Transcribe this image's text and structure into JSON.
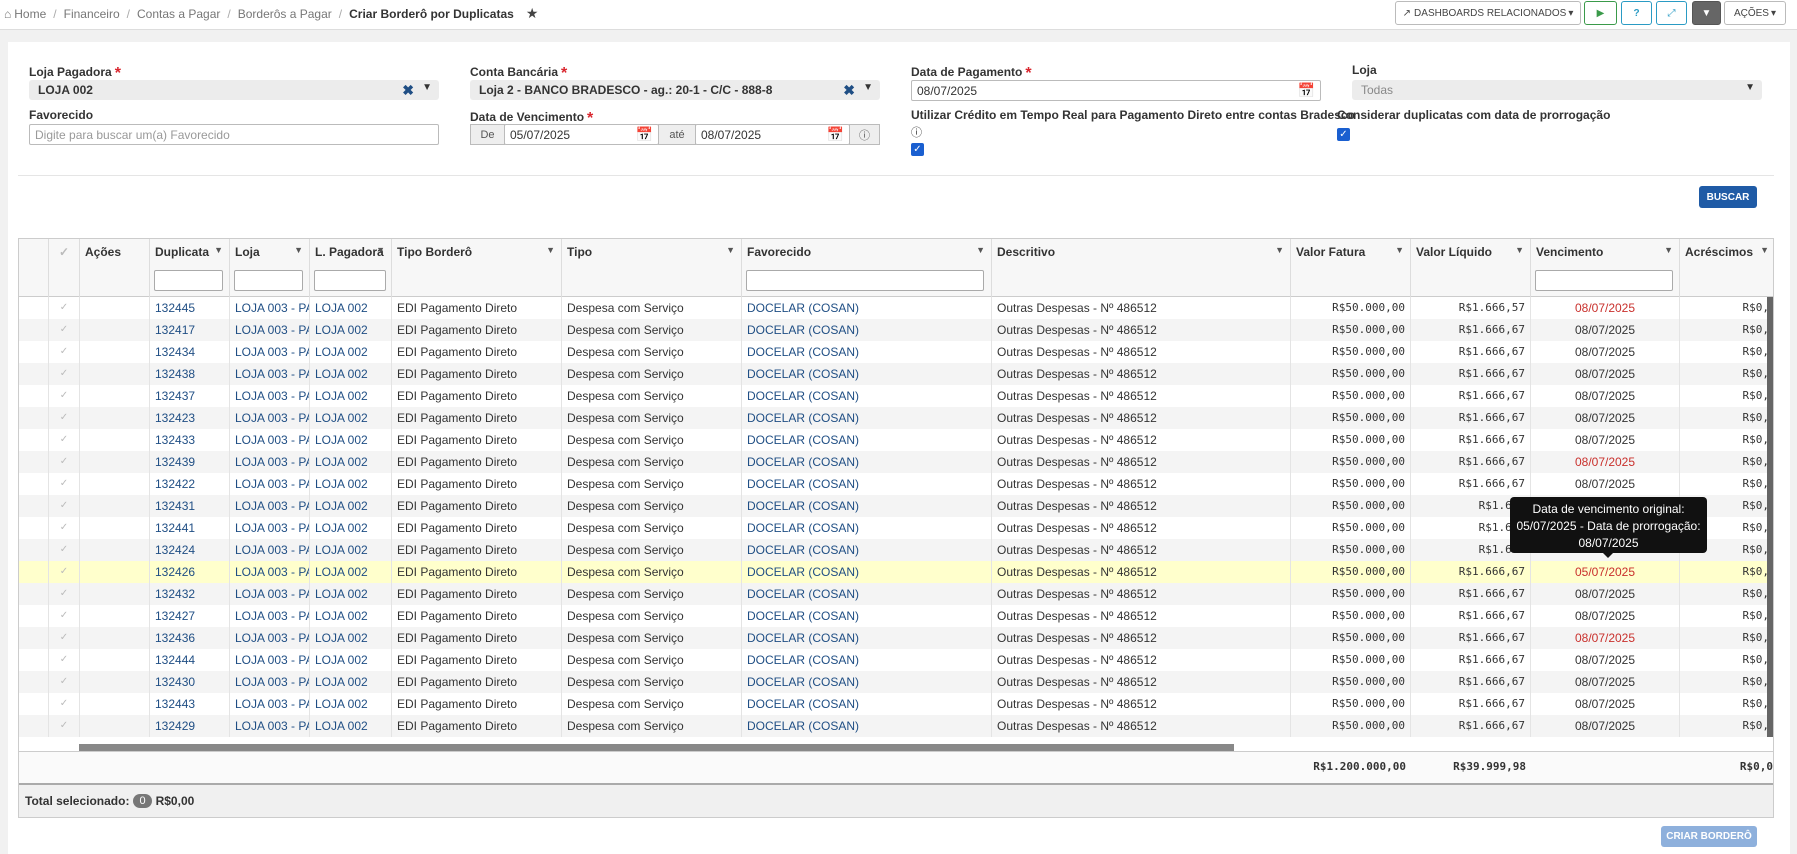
{
  "breadcrumb": {
    "home": "Home",
    "items": [
      "Financeiro",
      "Contas a Pagar",
      "Borderôs a Pagar"
    ],
    "current": "Criar Borderô por Duplicatas"
  },
  "toolbar": {
    "dashboards": "DASHBOARDS RELACIONADOS",
    "acoes": "AÇÕES"
  },
  "form": {
    "loja_pagadora": {
      "label": "Loja Pagadora",
      "value": "LOJA 002"
    },
    "conta_bancaria": {
      "label": "Conta Bancária",
      "value": "Loja 2 - BANCO BRADESCO - ag.: 20-1 - C/C - 888-8"
    },
    "data_pagamento": {
      "label": "Data de Pagamento",
      "value": "08/07/2025"
    },
    "loja": {
      "label": "Loja",
      "value": "Todas"
    },
    "favorecido": {
      "label": "Favorecido",
      "placeholder": "Digite para buscar um(a) Favorecido"
    },
    "data_vencimento": {
      "label": "Data de Vencimento",
      "de_label": "De",
      "de": "05/07/2025",
      "ate_label": "até",
      "ate": "08/07/2025"
    },
    "credito": {
      "label": "Utilizar Crédito em Tempo Real para Pagamento Direto entre contas Bradesco",
      "checked": true
    },
    "prorrogacao": {
      "label": "Considerar duplicatas com data de prorrogação",
      "checked": true
    },
    "buscar": "BUSCAR"
  },
  "grid": {
    "columns": [
      "Ações",
      "Duplicata",
      "Loja",
      "L. Pagadora",
      "Tipo Borderô",
      "Tipo",
      "Favorecido",
      "Descritivo",
      "Valor Fatura",
      "Valor Líquido",
      "Vencimento",
      "Acréscimos"
    ],
    "rows": [
      {
        "dup": "132445",
        "loja": "LOJA 003 - PAR",
        "lpag": "LOJA 002",
        "tipob": "EDI Pagamento Direto",
        "tipo": "Despesa com Serviço",
        "fav": "DOCELAR (COSAN)",
        "desc": "Outras Despesas - Nº 486512",
        "vf": "R$50.000,00",
        "vl": "R$1.666,57",
        "venc": "08/07/2025",
        "red": true,
        "acr": "R$0,"
      },
      {
        "dup": "132417",
        "loja": "LOJA 003 - PAR",
        "lpag": "LOJA 002",
        "tipob": "EDI Pagamento Direto",
        "tipo": "Despesa com Serviço",
        "fav": "DOCELAR (COSAN)",
        "desc": "Outras Despesas - Nº 486512",
        "vf": "R$50.000,00",
        "vl": "R$1.666,67",
        "venc": "08/07/2025",
        "red": false,
        "acr": "R$0,"
      },
      {
        "dup": "132434",
        "loja": "LOJA 003 - PAR",
        "lpag": "LOJA 002",
        "tipob": "EDI Pagamento Direto",
        "tipo": "Despesa com Serviço",
        "fav": "DOCELAR (COSAN)",
        "desc": "Outras Despesas - Nº 486512",
        "vf": "R$50.000,00",
        "vl": "R$1.666,67",
        "venc": "08/07/2025",
        "red": false,
        "acr": "R$0,"
      },
      {
        "dup": "132438",
        "loja": "LOJA 003 - PAR",
        "lpag": "LOJA 002",
        "tipob": "EDI Pagamento Direto",
        "tipo": "Despesa com Serviço",
        "fav": "DOCELAR (COSAN)",
        "desc": "Outras Despesas - Nº 486512",
        "vf": "R$50.000,00",
        "vl": "R$1.666,67",
        "venc": "08/07/2025",
        "red": false,
        "acr": "R$0,"
      },
      {
        "dup": "132437",
        "loja": "LOJA 003 - PAR",
        "lpag": "LOJA 002",
        "tipob": "EDI Pagamento Direto",
        "tipo": "Despesa com Serviço",
        "fav": "DOCELAR (COSAN)",
        "desc": "Outras Despesas - Nº 486512",
        "vf": "R$50.000,00",
        "vl": "R$1.666,67",
        "venc": "08/07/2025",
        "red": false,
        "acr": "R$0,"
      },
      {
        "dup": "132423",
        "loja": "LOJA 003 - PAR",
        "lpag": "LOJA 002",
        "tipob": "EDI Pagamento Direto",
        "tipo": "Despesa com Serviço",
        "fav": "DOCELAR (COSAN)",
        "desc": "Outras Despesas - Nº 486512",
        "vf": "R$50.000,00",
        "vl": "R$1.666,67",
        "venc": "08/07/2025",
        "red": false,
        "acr": "R$0,"
      },
      {
        "dup": "132433",
        "loja": "LOJA 003 - PAR",
        "lpag": "LOJA 002",
        "tipob": "EDI Pagamento Direto",
        "tipo": "Despesa com Serviço",
        "fav": "DOCELAR (COSAN)",
        "desc": "Outras Despesas - Nº 486512",
        "vf": "R$50.000,00",
        "vl": "R$1.666,67",
        "venc": "08/07/2025",
        "red": false,
        "acr": "R$0,"
      },
      {
        "dup": "132439",
        "loja": "LOJA 003 - PAR",
        "lpag": "LOJA 002",
        "tipob": "EDI Pagamento Direto",
        "tipo": "Despesa com Serviço",
        "fav": "DOCELAR (COSAN)",
        "desc": "Outras Despesas - Nº 486512",
        "vf": "R$50.000,00",
        "vl": "R$1.666,67",
        "venc": "08/07/2025",
        "red": true,
        "acr": "R$0,"
      },
      {
        "dup": "132422",
        "loja": "LOJA 003 - PAR",
        "lpag": "LOJA 002",
        "tipob": "EDI Pagamento Direto",
        "tipo": "Despesa com Serviço",
        "fav": "DOCELAR (COSAN)",
        "desc": "Outras Despesas - Nº 486512",
        "vf": "R$50.000,00",
        "vl": "R$1.666,67",
        "venc": "08/07/2025",
        "red": false,
        "acr": "R$0,"
      },
      {
        "dup": "132431",
        "loja": "LOJA 003 - PAR",
        "lpag": "LOJA 002",
        "tipob": "EDI Pagamento Direto",
        "tipo": "Despesa com Serviço",
        "fav": "DOCELAR (COSAN)",
        "desc": "Outras Despesas - Nº 486512",
        "vf": "R$50.000,00",
        "vl": "R$1.666",
        "venc": "",
        "red": false,
        "acr": "R$0,"
      },
      {
        "dup": "132441",
        "loja": "LOJA 003 - PAR",
        "lpag": "LOJA 002",
        "tipob": "EDI Pagamento Direto",
        "tipo": "Despesa com Serviço",
        "fav": "DOCELAR (COSAN)",
        "desc": "Outras Despesas - Nº 486512",
        "vf": "R$50.000,00",
        "vl": "R$1.666",
        "venc": "",
        "red": false,
        "acr": "R$0,"
      },
      {
        "dup": "132424",
        "loja": "LOJA 003 - PAR",
        "lpag": "LOJA 002",
        "tipob": "EDI Pagamento Direto",
        "tipo": "Despesa com Serviço",
        "fav": "DOCELAR (COSAN)",
        "desc": "Outras Despesas - Nº 486512",
        "vf": "R$50.000,00",
        "vl": "R$1.666",
        "venc": "",
        "red": false,
        "acr": "R$0,"
      },
      {
        "dup": "132426",
        "loja": "LOJA 003 - PAR",
        "lpag": "LOJA 002",
        "tipob": "EDI Pagamento Direto",
        "tipo": "Despesa com Serviço",
        "fav": "DOCELAR (COSAN)",
        "desc": "Outras Despesas - Nº 486512",
        "vf": "R$50.000,00",
        "vl": "R$1.666,67",
        "venc": "05/07/2025",
        "red": true,
        "acr": "R$0,",
        "hl": true
      },
      {
        "dup": "132432",
        "loja": "LOJA 003 - PAR",
        "lpag": "LOJA 002",
        "tipob": "EDI Pagamento Direto",
        "tipo": "Despesa com Serviço",
        "fav": "DOCELAR (COSAN)",
        "desc": "Outras Despesas - Nº 486512",
        "vf": "R$50.000,00",
        "vl": "R$1.666,67",
        "venc": "08/07/2025",
        "red": false,
        "acr": "R$0,"
      },
      {
        "dup": "132427",
        "loja": "LOJA 003 - PAR",
        "lpag": "LOJA 002",
        "tipob": "EDI Pagamento Direto",
        "tipo": "Despesa com Serviço",
        "fav": "DOCELAR (COSAN)",
        "desc": "Outras Despesas - Nº 486512",
        "vf": "R$50.000,00",
        "vl": "R$1.666,67",
        "venc": "08/07/2025",
        "red": false,
        "acr": "R$0,"
      },
      {
        "dup": "132436",
        "loja": "LOJA 003 - PAR",
        "lpag": "LOJA 002",
        "tipob": "EDI Pagamento Direto",
        "tipo": "Despesa com Serviço",
        "fav": "DOCELAR (COSAN)",
        "desc": "Outras Despesas - Nº 486512",
        "vf": "R$50.000,00",
        "vl": "R$1.666,67",
        "venc": "08/07/2025",
        "red": true,
        "acr": "R$0,"
      },
      {
        "dup": "132444",
        "loja": "LOJA 003 - PAR",
        "lpag": "LOJA 002",
        "tipob": "EDI Pagamento Direto",
        "tipo": "Despesa com Serviço",
        "fav": "DOCELAR (COSAN)",
        "desc": "Outras Despesas - Nº 486512",
        "vf": "R$50.000,00",
        "vl": "R$1.666,67",
        "venc": "08/07/2025",
        "red": false,
        "acr": "R$0,"
      },
      {
        "dup": "132430",
        "loja": "LOJA 003 - PAR",
        "lpag": "LOJA 002",
        "tipob": "EDI Pagamento Direto",
        "tipo": "Despesa com Serviço",
        "fav": "DOCELAR (COSAN)",
        "desc": "Outras Despesas - Nº 486512",
        "vf": "R$50.000,00",
        "vl": "R$1.666,67",
        "venc": "08/07/2025",
        "red": false,
        "acr": "R$0,"
      },
      {
        "dup": "132443",
        "loja": "LOJA 003 - PAR",
        "lpag": "LOJA 002",
        "tipob": "EDI Pagamento Direto",
        "tipo": "Despesa com Serviço",
        "fav": "DOCELAR (COSAN)",
        "desc": "Outras Despesas - Nº 486512",
        "vf": "R$50.000,00",
        "vl": "R$1.666,67",
        "venc": "08/07/2025",
        "red": false,
        "acr": "R$0,"
      },
      {
        "dup": "132429",
        "loja": "LOJA 003 - PAR",
        "lpag": "LOJA 002",
        "tipob": "EDI Pagamento Direto",
        "tipo": "Despesa com Serviço",
        "fav": "DOCELAR (COSAN)",
        "desc": "Outras Despesas - Nº 486512",
        "vf": "R$50.000,00",
        "vl": "R$1.666,67",
        "venc": "08/07/2025",
        "red": false,
        "acr": "R$0,"
      }
    ],
    "totals": {
      "vf": "R$1.200.000,00",
      "vl": "R$39.999,98",
      "acr": "R$0,0"
    },
    "total_selecionado_label": "Total selecionado:",
    "total_selecionado_count": "0",
    "total_selecionado_value": "R$0,00"
  },
  "tooltip": "Data de vencimento original: 05/07/2025 - Data de prorrogação: 08/07/2025",
  "criar_bordero": "CRIAR BORDERÔ"
}
